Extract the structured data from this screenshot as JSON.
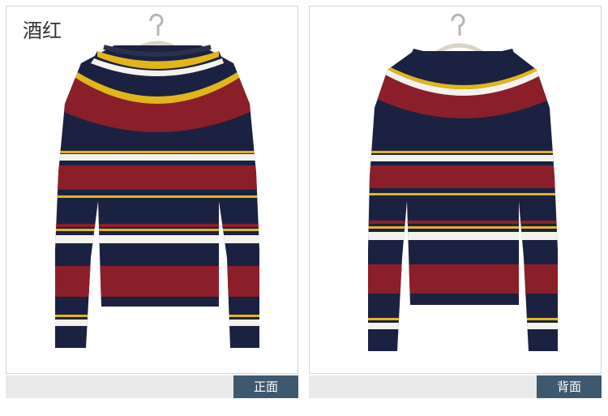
{
  "color_name": "酒红",
  "views": {
    "front_label": "正面",
    "back_label": "背面"
  },
  "colors": {
    "navy": "#1b2140",
    "wine": "#8a1f2a",
    "white": "#f4f2ec",
    "yellow": "#e2b51a",
    "tab": "#3e5870",
    "strip": "#e9e9e9"
  }
}
